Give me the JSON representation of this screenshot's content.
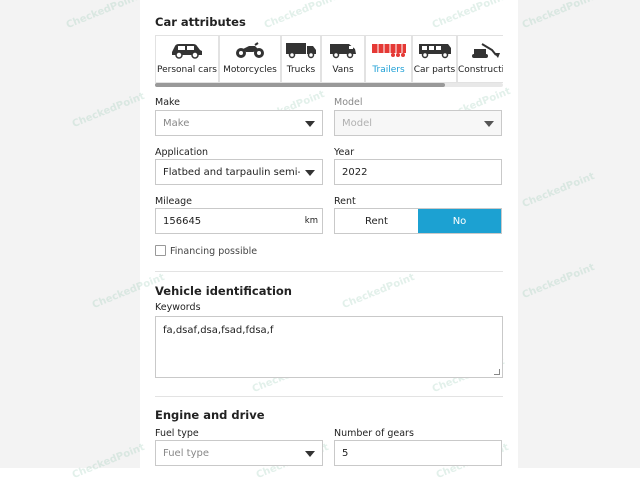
{
  "section_car_attributes": {
    "title": "Car attributes"
  },
  "categories": [
    {
      "label": "Personal cars",
      "icon": "car-icon"
    },
    {
      "label": "Motorcycles",
      "icon": "motorcycle-icon"
    },
    {
      "label": "Trucks",
      "icon": "truck-icon"
    },
    {
      "label": "Vans",
      "icon": "van-icon"
    },
    {
      "label": "Trailers",
      "icon": "trailer-icon",
      "active": true
    },
    {
      "label": "Car parts",
      "icon": "car-parts-icon"
    },
    {
      "label": "Construction",
      "icon": "excavator-icon"
    }
  ],
  "make": {
    "label": "Make",
    "placeholder": "Make"
  },
  "model": {
    "label": "Model",
    "placeholder": "Model"
  },
  "application": {
    "label": "Application",
    "value": "Flatbed and tarpaulin semi-trailers"
  },
  "year": {
    "label": "Year",
    "value": "2022"
  },
  "mileage": {
    "label": "Mileage",
    "value": "156645",
    "unit": "km"
  },
  "rent": {
    "label": "Rent",
    "option_rent": "Rent",
    "option_no": "No",
    "selected": "No"
  },
  "financing": {
    "label": "Financing possible",
    "checked": false
  },
  "section_vehicle_identification": {
    "title": "Vehicle identification"
  },
  "keywords": {
    "label": "Keywords",
    "value": "fa,dsaf,dsa,fsad,fdsa,f"
  },
  "section_engine": {
    "title": "Engine and drive"
  },
  "fuel_type": {
    "label": "Fuel type",
    "placeholder": "Fuel type"
  },
  "gears": {
    "label": "Number of gears",
    "value": "5"
  },
  "watermark": "CheckedPoint",
  "colors": {
    "accent": "#1ca1d2",
    "active_icon": "#e53935"
  }
}
